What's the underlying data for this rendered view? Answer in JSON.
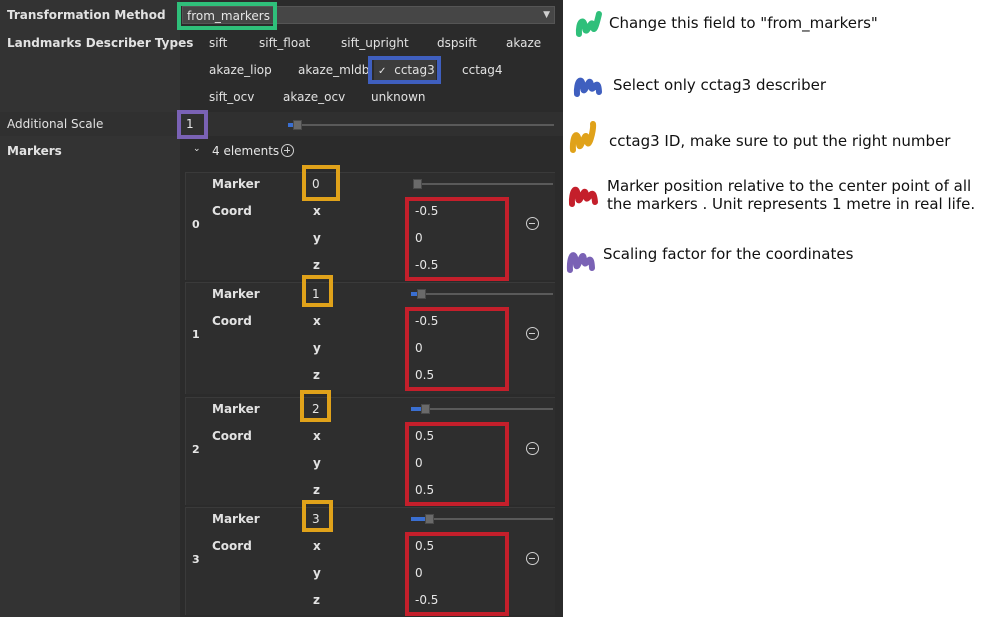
{
  "colors": {
    "green": "#2fbf7a",
    "blue": "#3f5fbf",
    "yellow": "#e0a21a",
    "red": "#c41f2b",
    "purple": "#7a62b5",
    "panel_bg": "#2b2b2b"
  },
  "form": {
    "transformation_method_label": "Transformation Method",
    "transformation_method_value": "from_markers",
    "describer_label": "Landmarks Describer Types",
    "describers": [
      "sift",
      "sift_float",
      "sift_upright",
      "dspsift",
      "akaze",
      "akaze_liop",
      "akaze_mldb",
      "cctag3",
      "cctag4",
      "sift_ocv",
      "akaze_ocv",
      "unknown"
    ],
    "selected_describer": "cctag3",
    "selected_check": "✓",
    "additional_scale_label": "Additional Scale",
    "additional_scale_value": "1",
    "markers_label": "Markers",
    "markers_count_text": "4 elements",
    "marker_field_label": "Marker",
    "coord_field_label": "Coord",
    "axis_x": "x",
    "axis_y": "y",
    "axis_z": "z",
    "markers": [
      {
        "index": "0",
        "id": "0",
        "x": "-0.5",
        "y": "0",
        "z": "-0.5",
        "slider_fraction": 0.0
      },
      {
        "index": "1",
        "id": "1",
        "x": "-0.5",
        "y": "0",
        "z": "0.5",
        "slider_fraction": 0.1
      },
      {
        "index": "2",
        "id": "2",
        "x": "0.5",
        "y": "0",
        "z": "0.5",
        "slider_fraction": 0.2
      },
      {
        "index": "3",
        "id": "3",
        "x": "0.5",
        "y": "0",
        "z": "-0.5",
        "slider_fraction": 0.3
      }
    ]
  },
  "annotations": [
    {
      "color": "green",
      "text": "Change this field to \"from_markers\""
    },
    {
      "color": "blue",
      "text": "Select only cctag3 describer"
    },
    {
      "color": "yellow",
      "text": "cctag3 ID, make sure to put the right number"
    },
    {
      "color": "red",
      "text_line1": "Marker position relative to the center point of all",
      "text_line2": "the markers . Unit represents 1 metre in real life."
    },
    {
      "color": "purple",
      "text": "Scaling factor for the coordinates"
    }
  ]
}
